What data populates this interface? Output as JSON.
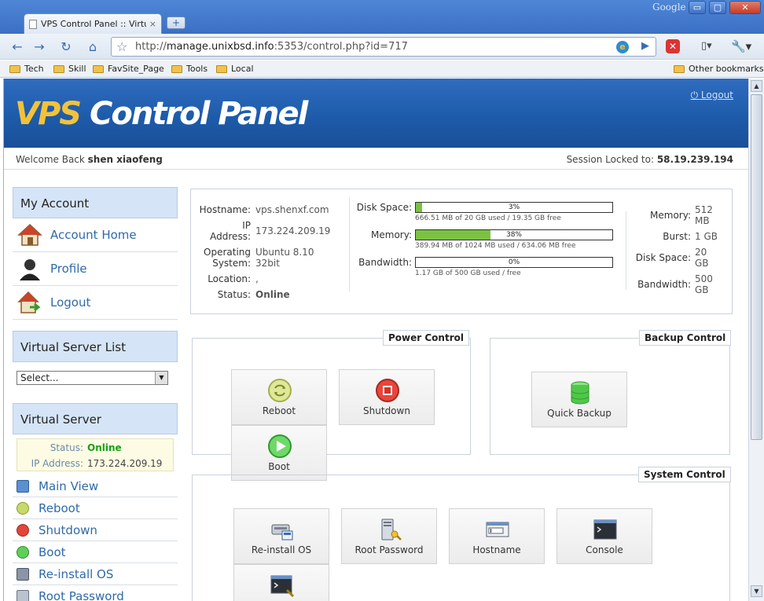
{
  "browser": {
    "tab_title": "VPS Control Panel :: Virtual...",
    "tab_close": "×",
    "new_tab": "+",
    "google": "Google",
    "window_buttons": [
      "▭",
      "▢",
      "✕"
    ],
    "url_scheme": "http://",
    "url_host": "manage.unixbsd.info",
    "url_rest": ":5353/control.php?id=717",
    "bookmarks": [
      "Tech",
      "Skill",
      "FavSite_Page",
      "Tools",
      "Local"
    ],
    "other_bookmarks": "Other bookmarks"
  },
  "header": {
    "title_a": "VPS",
    "title_b": " Control Panel",
    "logout": "Logout",
    "welcome_prefix": "Welcome Back ",
    "user": "shen xiaofeng",
    "session_prefix": "Session Locked to: ",
    "session_ip": "58.19.239.194"
  },
  "sidebar": {
    "my_account": "My Account",
    "account_items": [
      "Account Home",
      "Profile",
      "Logout"
    ],
    "vs_list": "Virtual Server List",
    "select_value": "Select...",
    "vs_head": "Virtual Server",
    "status_label": "Status:",
    "status_value": "Online",
    "ip_label": "IP Address:",
    "ip_value": "173.224.209.19",
    "actions": [
      "Main View",
      "Reboot",
      "Shutdown",
      "Boot",
      "Re-install OS",
      "Root Password"
    ]
  },
  "stats": {
    "hostname_label": "Hostname:",
    "hostname": "vps.shenxf.com",
    "ip_label_1": "IP",
    "ip_label_2": "Address:",
    "ip": "173.224.209.19",
    "os_label_1": "Operating",
    "os_label_2": "System:",
    "os_1": "Ubuntu 8.10",
    "os_2": "32bit",
    "location_label": "Location:",
    "location": ",",
    "status_label": "Status:",
    "status": "Online",
    "disk_label": "Disk Space:",
    "disk_pct": "3%",
    "disk_fraction": 0.03,
    "disk_sub": "666.51 MB of 20 GB used / 19.35 GB free",
    "mem_label": "Memory:",
    "mem_pct": "38%",
    "mem_fraction": 0.38,
    "mem_sub": "389.94 MB of 1024 MB used / 634.06 MB free",
    "bw_label": "Bandwidth:",
    "bw_pct": "0%",
    "bw_fraction": 0,
    "bw_sub": "1.17 GB of 500 GB used / free",
    "r_memory_label": "Memory:",
    "r_memory_1": "512",
    "r_memory_2": "MB",
    "r_burst_label": "Burst:",
    "r_burst": "1 GB",
    "r_disk_label": "Disk Space:",
    "r_disk_1": "20",
    "r_disk_2": "GB",
    "r_bw_label": "Bandwidth:",
    "r_bw_1": "500",
    "r_bw_2": "GB"
  },
  "power": {
    "title": "Power Control",
    "reboot": "Reboot",
    "shutdown": "Shutdown",
    "boot": "Boot"
  },
  "backup": {
    "title": "Backup Control",
    "quick": "Quick Backup"
  },
  "system": {
    "title": "System Control",
    "reinstall": "Re-install OS",
    "rootpw": "Root Password",
    "hostname": "Hostname",
    "console": "Console"
  }
}
